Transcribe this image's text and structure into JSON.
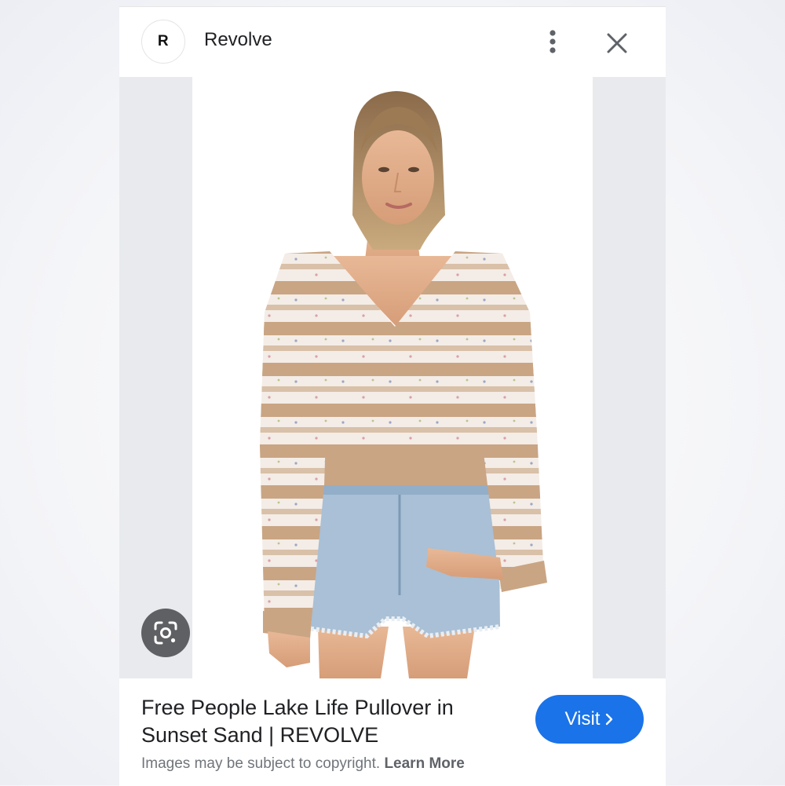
{
  "header": {
    "logo_letter": "R",
    "site_name": "Revolve"
  },
  "icons": {
    "more": "more-vert-icon",
    "close": "close-icon",
    "lens": "google-lens-icon",
    "chevron": "chevron-right-icon"
  },
  "result": {
    "title_line1": "Free People Lake Life Pullover in",
    "title_line2": "Sunset Sand | REVOLVE",
    "visit_label": "Visit",
    "copyright_text": "Images may be subject to copyright.",
    "learn_more": "Learn More"
  },
  "colors": {
    "accent": "#1a73e8",
    "lens_button": "#5f6063",
    "image_margin": "#e8eaed"
  }
}
